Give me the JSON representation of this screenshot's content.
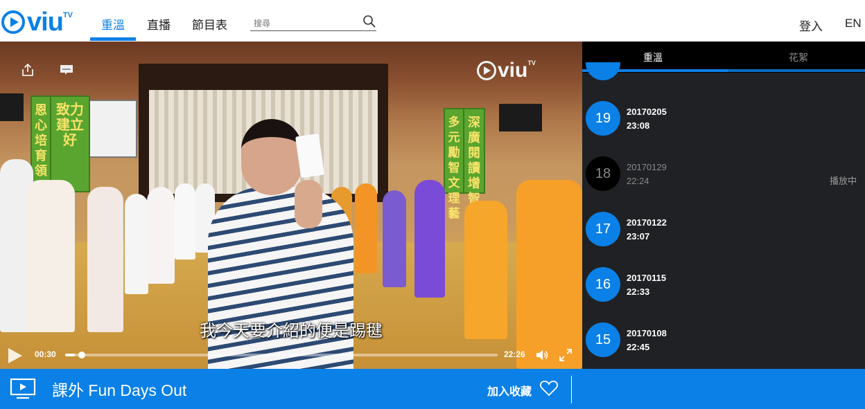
{
  "header": {
    "logo_text": "viu",
    "logo_suffix": "TV",
    "nav": [
      {
        "label": "重溫",
        "active": true
      },
      {
        "label": "直播",
        "active": false
      },
      {
        "label": "節目表",
        "active": false
      }
    ],
    "search_placeholder": "搜尋",
    "login_label": "登入",
    "lang_label": "EN"
  },
  "player": {
    "watermark_text": "viu",
    "watermark_suffix": "TV",
    "subtitle": "我今天要介紹的便是踢毽",
    "current_time": "00:30",
    "total_time": "22:26",
    "progress": 0.022,
    "banners": [
      {
        "text": "致力建立好"
      },
      {
        "text": "恩心培育領"
      },
      {
        "text": "深廣閱讀增智"
      },
      {
        "text": "多元勵智文理藝"
      }
    ]
  },
  "side": {
    "tabs": [
      {
        "label": "重溫",
        "active": true
      },
      {
        "label": "花絮",
        "active": false
      }
    ],
    "episodes": [
      {
        "number": "19",
        "date": "20170205",
        "time": "23:08",
        "playing": false,
        "status": ""
      },
      {
        "number": "18",
        "date": "20170129",
        "time": "22:24",
        "playing": true,
        "status": "播放中"
      },
      {
        "number": "17",
        "date": "20170122",
        "time": "23:07",
        "playing": false,
        "status": ""
      },
      {
        "number": "16",
        "date": "20170115",
        "time": "22:33",
        "playing": false,
        "status": ""
      },
      {
        "number": "15",
        "date": "20170108",
        "time": "22:45",
        "playing": false,
        "status": ""
      }
    ]
  },
  "bottom": {
    "show_title": "課外 Fun Days Out",
    "favorite_label": "加入收藏"
  },
  "colors": {
    "accent": "#0b80e6",
    "side_bg": "#202124",
    "tab_bg": "#000000"
  },
  "icons": [
    "search-icon",
    "share-icon",
    "subtitle-icon",
    "play-icon",
    "volume-icon",
    "fullscreen-icon",
    "tv-icon",
    "heart-icon"
  ]
}
